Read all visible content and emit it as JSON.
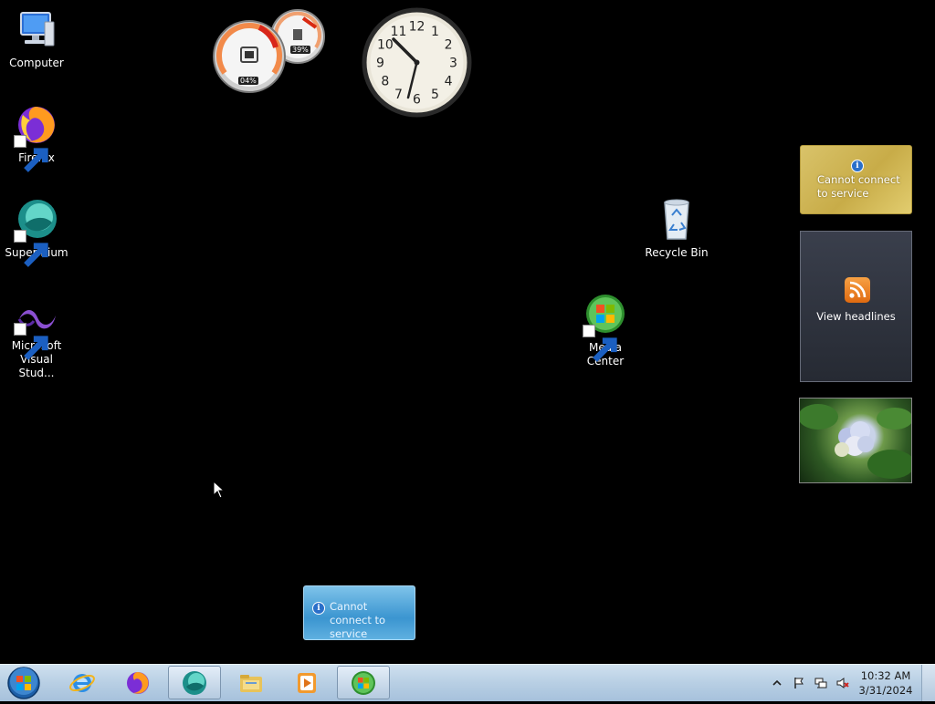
{
  "desktop_icons": [
    {
      "label": "Computer",
      "icon": "computer-icon"
    },
    {
      "label": "Firefox",
      "icon": "firefox-icon"
    },
    {
      "label": "Supermium",
      "icon": "supermium-icon"
    },
    {
      "label": "Microsoft Visual Stud...",
      "icon": "visual-studio-icon"
    },
    {
      "label": "Recycle Bin",
      "icon": "recycle-bin-icon"
    },
    {
      "label": "Media Center",
      "icon": "media-center-icon"
    }
  ],
  "gadgets": {
    "cpu_meter": {
      "cpu": "04%",
      "memory": "39%"
    },
    "clock": {
      "numerals": [
        "12",
        "1",
        "2",
        "3",
        "4",
        "5",
        "6",
        "7",
        "8",
        "9",
        "10",
        "11"
      ]
    },
    "weather": {
      "message": "Cannot connect to service"
    },
    "feed": {
      "label": "View headlines"
    },
    "stocks": {
      "message": "Cannot connect to service"
    }
  },
  "taskbar": {
    "time": "10:32 AM",
    "date": "3/31/2024",
    "pinned": [
      "internet-explorer-icon",
      "firefox-icon",
      "supermium-icon",
      "file-explorer-icon",
      "media-player-icon",
      "media-center-icon"
    ]
  },
  "colors": {
    "taskbar": "#b8cfe4",
    "desktop": "#000000",
    "weather": "#d9c36a",
    "stocks": "#3b95d0"
  }
}
